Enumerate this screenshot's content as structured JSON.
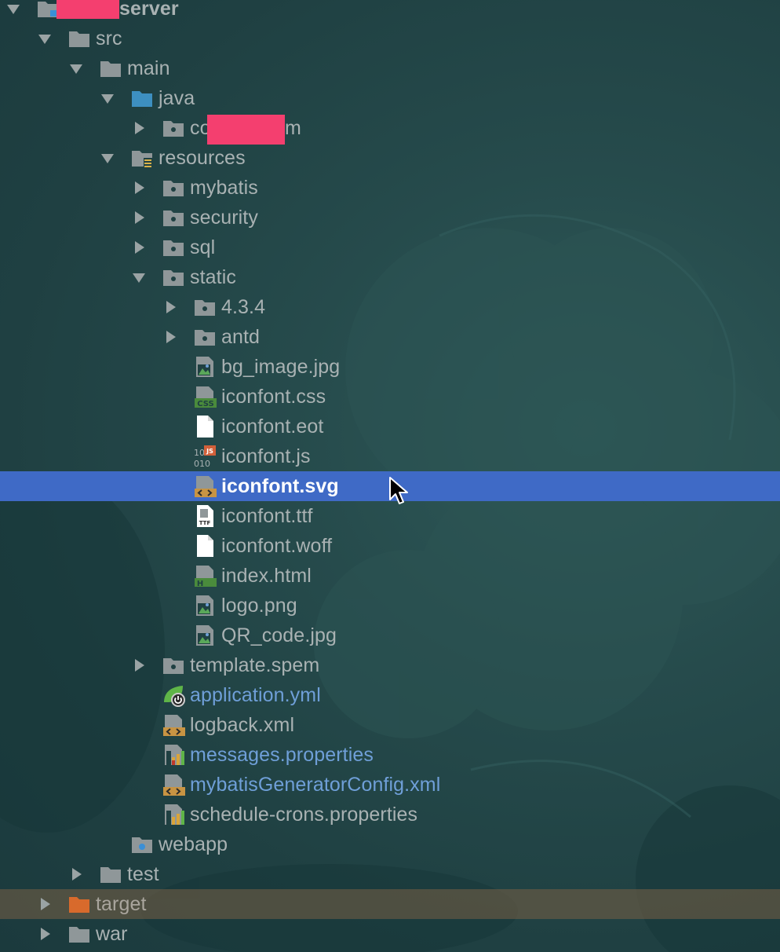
{
  "colors": {
    "selected_bg": "#3f6ac6",
    "excluded_bg": "#7a6046",
    "text_default": "#a9b2b3",
    "text_modified": "#6f9fd8",
    "redaction": "#f43f6f"
  },
  "tree": {
    "root": {
      "label_suffix": "server",
      "icon": "module-folder-icon",
      "expanded": true
    },
    "src": {
      "label": "src",
      "icon": "folder-icon",
      "expanded": true
    },
    "main": {
      "label": "main",
      "icon": "folder-icon",
      "expanded": true
    },
    "java": {
      "label": "java",
      "icon": "source-root-folder-icon",
      "expanded": true
    },
    "package": {
      "label_prefix": "co",
      "label_suffix": "m",
      "icon": "package-icon",
      "expanded": false
    },
    "resources": {
      "label": "resources",
      "icon": "resources-folder-icon",
      "expanded": true
    },
    "mybatis": {
      "label": "mybatis",
      "icon": "package-icon",
      "expanded": false
    },
    "security": {
      "label": "security",
      "icon": "package-icon",
      "expanded": false
    },
    "sql": {
      "label": "sql",
      "icon": "package-icon",
      "expanded": false
    },
    "static": {
      "label": "static",
      "icon": "package-icon",
      "expanded": true
    },
    "v434": {
      "label": "4.3.4",
      "icon": "package-icon",
      "expanded": false
    },
    "antd": {
      "label": "antd",
      "icon": "package-icon",
      "expanded": false
    },
    "bg_image": {
      "label": "bg_image.jpg",
      "icon": "image-file-icon"
    },
    "iconfont_css": {
      "label": "iconfont.css",
      "icon": "css-file-icon",
      "badge": "CSS"
    },
    "iconfont_eot": {
      "label": "iconfont.eot",
      "icon": "blank-file-icon"
    },
    "iconfont_js": {
      "label": "iconfont.js",
      "icon": "binary-js-file-icon",
      "badge": "JS",
      "binary_top": "10",
      "binary_bottom": "010"
    },
    "iconfont_svg": {
      "label": "iconfont.svg",
      "icon": "xml-file-icon",
      "selected": true
    },
    "iconfont_ttf": {
      "label": "iconfont.ttf",
      "icon": "font-file-icon",
      "badge": "TTF"
    },
    "iconfont_woff": {
      "label": "iconfont.woff",
      "icon": "blank-file-icon"
    },
    "index_html": {
      "label": "index.html",
      "icon": "html-file-icon",
      "badge": "H"
    },
    "logo_png": {
      "label": "logo.png",
      "icon": "image-file-icon"
    },
    "qr_code": {
      "label": "QR_code.jpg",
      "icon": "image-file-icon"
    },
    "template_spem": {
      "label": "template.spem",
      "icon": "package-icon",
      "expanded": false
    },
    "application_yml": {
      "label": "application.yml",
      "icon": "spring-config-icon",
      "modified": true
    },
    "logback_xml": {
      "label": "logback.xml",
      "icon": "xml-file-icon"
    },
    "messages_props": {
      "label": "messages.properties",
      "icon": "properties-file-icon",
      "modified": true
    },
    "mybatis_gen": {
      "label": "mybatisGeneratorConfig.xml",
      "icon": "xml-file-icon",
      "modified": true
    },
    "schedule_crons": {
      "label": "schedule-crons.properties",
      "icon": "properties-file-icon"
    },
    "webapp": {
      "label": "webapp",
      "icon": "web-folder-icon"
    },
    "test": {
      "label": "test",
      "icon": "folder-icon",
      "expanded": false
    },
    "target": {
      "label": "target",
      "icon": "excluded-folder-icon",
      "expanded": false,
      "excluded": true
    },
    "war": {
      "label": "war",
      "icon": "folder-icon",
      "expanded": false
    }
  }
}
